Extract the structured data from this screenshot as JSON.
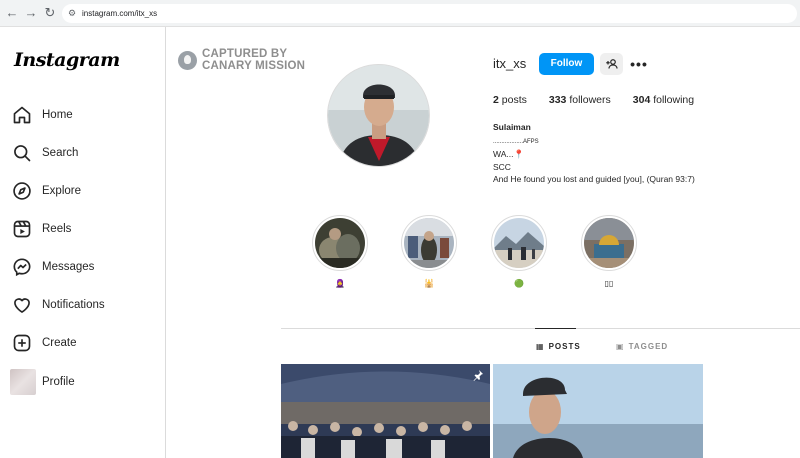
{
  "browser": {
    "url": "instagram.com/itx_xs",
    "back_glyph": "←",
    "forward_glyph": "→",
    "reload_glyph": "↻",
    "tune_glyph": "⚙"
  },
  "sidebar": {
    "logo": "Instagram",
    "items": [
      {
        "label": "Home",
        "icon": "home-icon"
      },
      {
        "label": "Search",
        "icon": "search-icon"
      },
      {
        "label": "Explore",
        "icon": "compass-icon"
      },
      {
        "label": "Reels",
        "icon": "reels-icon"
      },
      {
        "label": "Messages",
        "icon": "messenger-icon"
      },
      {
        "label": "Notifications",
        "icon": "heart-icon"
      },
      {
        "label": "Create",
        "icon": "plus-square-icon"
      },
      {
        "label": "Profile",
        "icon": "avatar"
      }
    ]
  },
  "watermark": {
    "line1": "CAPTURED BY",
    "line2": "CANARY MISSION"
  },
  "profile": {
    "username": "itx_xs",
    "follow_label": "Follow",
    "more_label": "•••",
    "stats": {
      "posts_count": "2",
      "posts_label": "posts",
      "followers_count": "333",
      "followers_label": "followers",
      "following_count": "304",
      "following_label": "following"
    },
    "bio": {
      "name": "Sulaiman",
      "line1_dots": "..................",
      "line1_tag": "AFPS",
      "line2": "WA...📍",
      "line3": "SCC",
      "line4": "And He found you lost and guided [you], (Quran 93:7)"
    }
  },
  "highlights": [
    {
      "caption": "🧕"
    },
    {
      "caption": "🕌"
    },
    {
      "caption": "🟢"
    },
    {
      "caption": "▯▯"
    }
  ],
  "tabs": {
    "posts": "POSTS",
    "tagged": "TAGGED",
    "posts_icon": "▦",
    "tagged_icon": "▣"
  },
  "colors": {
    "follow_blue": "#0095f6",
    "border": "#dbdbdb"
  }
}
